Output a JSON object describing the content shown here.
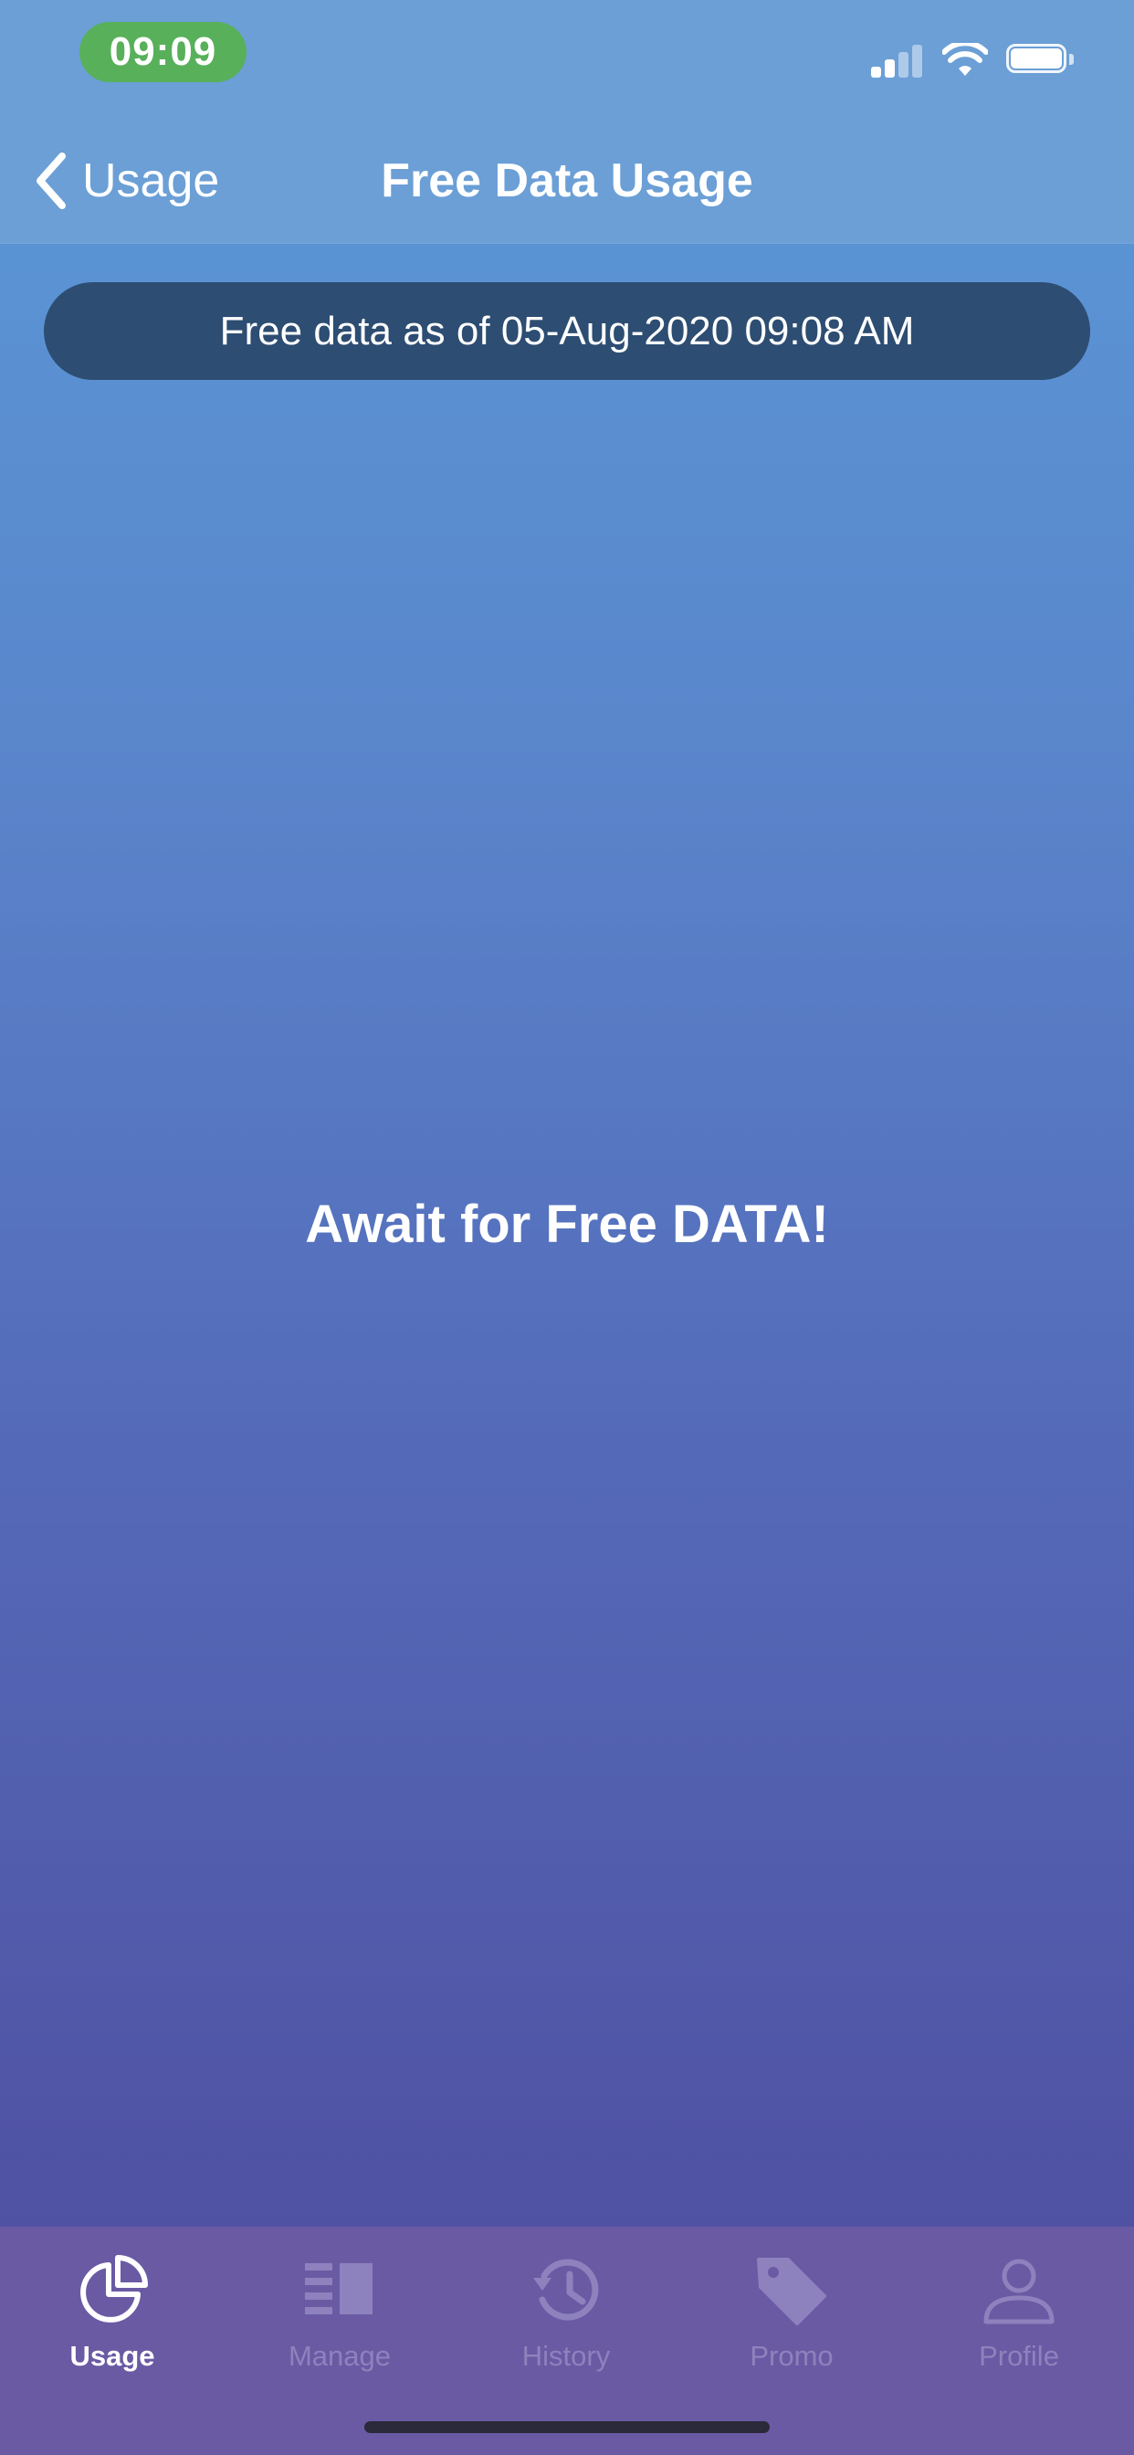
{
  "status_bar": {
    "time": "09:09",
    "time_pill_color": "#58b05a",
    "signal_icon": "cellular-signal-icon",
    "wifi_icon": "wifi-icon",
    "battery_icon": "battery-icon"
  },
  "nav": {
    "back_label": "Usage",
    "title": "Free Data Usage"
  },
  "info": {
    "text": "Free data as of 05-Aug-2020 09:08 AM"
  },
  "main": {
    "message": "Await for Free DATA!"
  },
  "tabs": [
    {
      "label": "Usage",
      "icon": "pie-chart-icon",
      "active": true
    },
    {
      "label": "Manage",
      "icon": "list-icon",
      "active": false
    },
    {
      "label": "History",
      "icon": "history-icon",
      "active": false
    },
    {
      "label": "Promo",
      "icon": "tag-icon",
      "active": false
    },
    {
      "label": "Profile",
      "icon": "person-icon",
      "active": false
    }
  ],
  "colors": {
    "active_tab": "#ffffff",
    "inactive_tab": "#8d82bd",
    "tab_bar_bg": "#6a5aa4",
    "info_pill_bg": "#2d4d72"
  }
}
